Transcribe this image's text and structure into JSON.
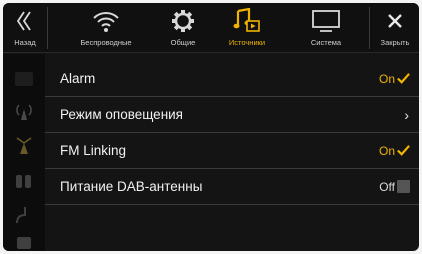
{
  "topbar": {
    "back_label": "Назад",
    "wireless_label": "Беспроводные",
    "general_label": "Общие",
    "sources_label": "Источники",
    "system_label": "Система",
    "close_label": "Закрыть"
  },
  "settings": {
    "rows": [
      {
        "label": "Alarm",
        "value": "On"
      },
      {
        "label": "Режим оповещения",
        "value": ""
      },
      {
        "label": "FM Linking",
        "value": "On"
      },
      {
        "label": "Питание DAB-антенны",
        "value": "Off"
      }
    ]
  },
  "colors": {
    "accent": "#f0b400",
    "background": "#141414",
    "divider": "#3b3b3b"
  },
  "icons": [
    "back-icon",
    "wifi-icon",
    "gear-icon",
    "music-source-icon",
    "monitor-icon",
    "close-icon"
  ]
}
